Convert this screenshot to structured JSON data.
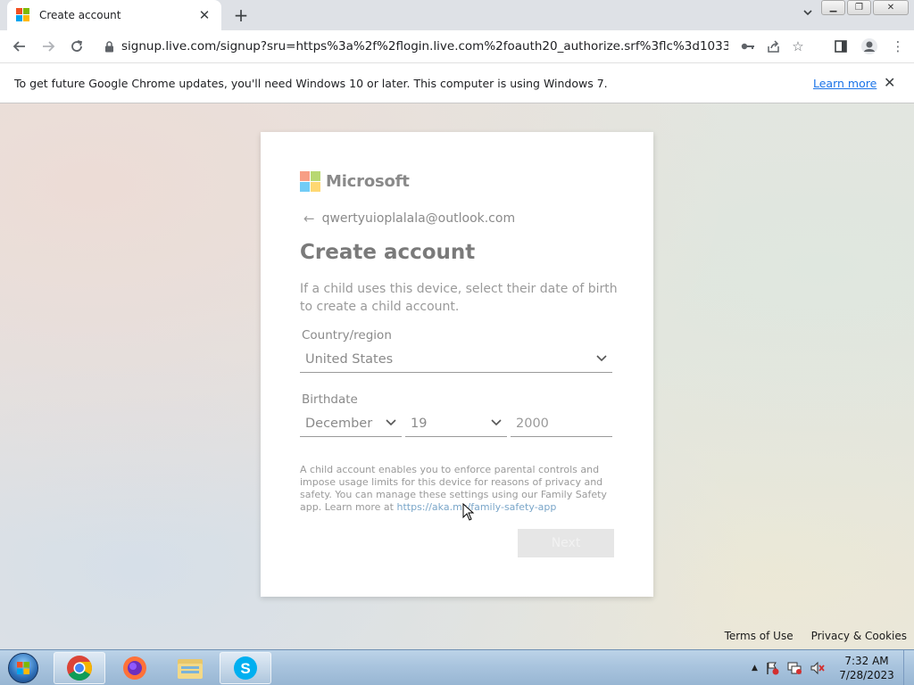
{
  "browser": {
    "tab_title": "Create account",
    "new_tab_label": "+",
    "url": "signup.live.com/signup?sru=https%3a%2f%2flogin.live.com%2foauth20_authorize.srf%3flc%3d1033%26clie...",
    "infobar_text": "To get future Google Chrome updates, you'll need Windows 10 or later. This computer is using Windows 7.",
    "infobar_link": "Learn more"
  },
  "signup": {
    "brand": "Microsoft",
    "email": "qwertyuioplalala@outlook.com",
    "heading": "Create account",
    "description": "If a child uses this device, select their date of birth to create a child account.",
    "country_label": "Country/region",
    "country_value": "United States",
    "birthdate_label": "Birthdate",
    "month_value": "December",
    "day_value": "19",
    "year_value": "2000",
    "notice_text": "A child account enables you to enforce parental controls and impose usage limits for this device for reasons of privacy and safety. You can manage these settings using our Family Safety app. Learn more at ",
    "notice_link": "https://aka.ms/family-safety-app",
    "next_label": "Next"
  },
  "footer": {
    "terms": "Terms of Use",
    "privacy": "Privacy & Cookies"
  },
  "taskbar": {
    "time": "7:32 AM",
    "date": "7/28/2023"
  }
}
